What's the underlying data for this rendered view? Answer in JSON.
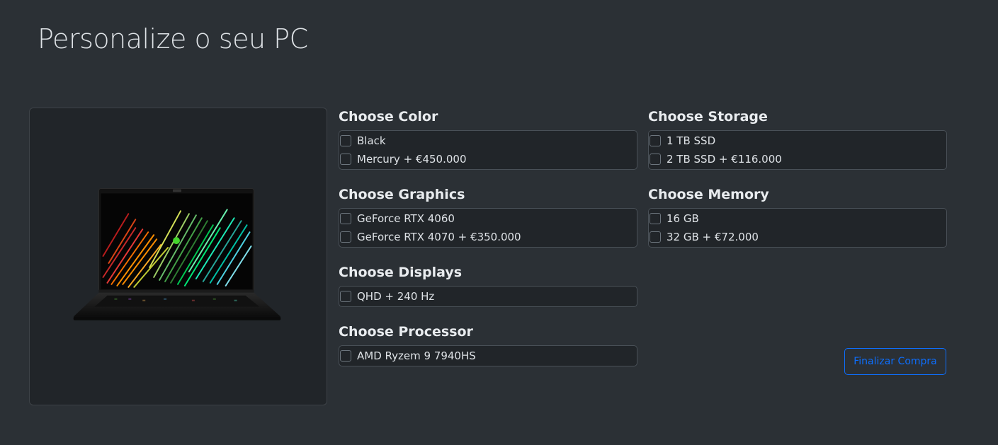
{
  "page": {
    "title": "Personalize o seu PC"
  },
  "groups": {
    "color": {
      "title": "Choose Color",
      "options": [
        {
          "label": "Black"
        },
        {
          "label": "Mercury + €450.000"
        }
      ]
    },
    "graphics": {
      "title": "Choose Graphics",
      "options": [
        {
          "label": "GeForce RTX 4060"
        },
        {
          "label": "GeForce RTX 4070 + €350.000"
        }
      ]
    },
    "displays": {
      "title": "Choose Displays",
      "options": [
        {
          "label": "QHD + 240 Hz"
        }
      ]
    },
    "processor": {
      "title": "Choose Processor",
      "options": [
        {
          "label": "AMD Ryzem 9 7940HS"
        }
      ]
    },
    "storage": {
      "title": "Choose Storage",
      "options": [
        {
          "label": "1 TB SSD"
        },
        {
          "label": "2 TB SSD + €116.000"
        }
      ]
    },
    "memory": {
      "title": "Choose Memory",
      "options": [
        {
          "label": "16 GB"
        },
        {
          "label": "32 GB + €72.000"
        }
      ]
    }
  },
  "actions": {
    "finalize_label": "Finalizar Compra"
  },
  "colors": {
    "accent": "#0d6efd",
    "background": "#2b3035",
    "panel": "#212529"
  }
}
